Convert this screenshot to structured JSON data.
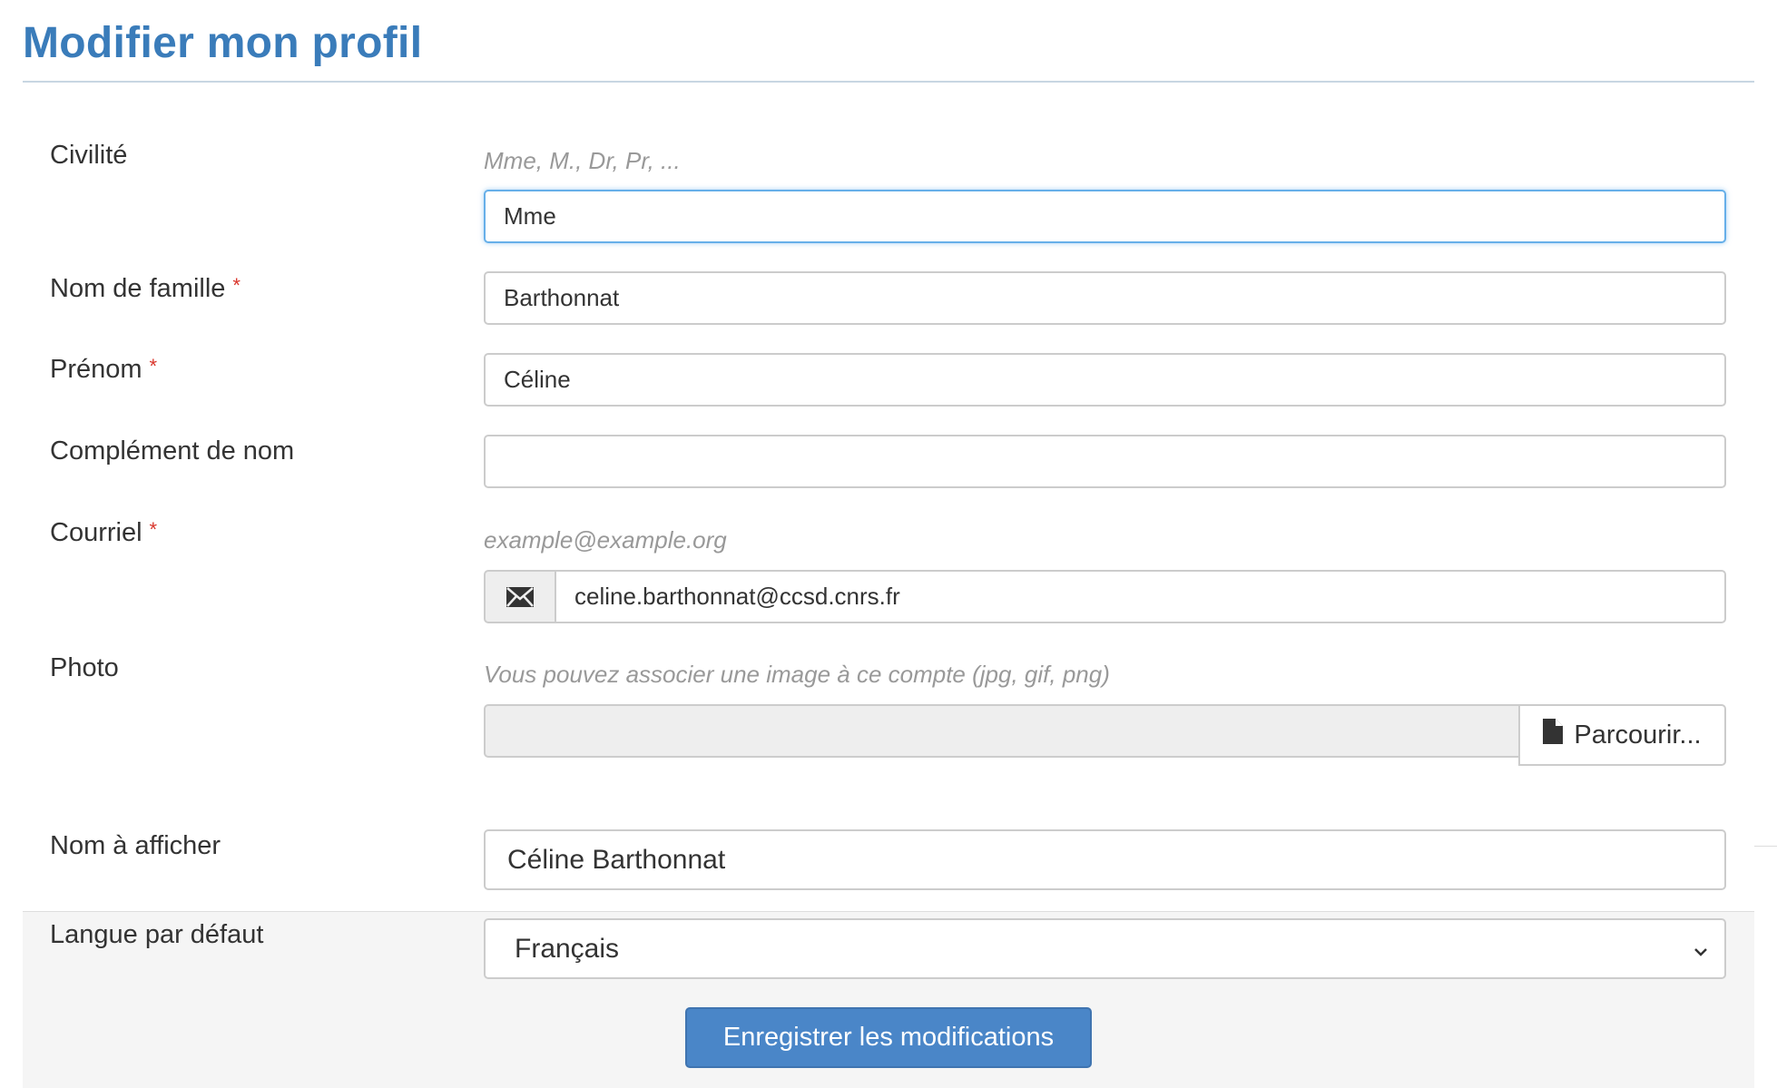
{
  "page": {
    "title": "Modifier mon profil"
  },
  "form": {
    "civilite": {
      "label": "Civilité",
      "hint": "Mme, M., Dr, Pr, ...",
      "value": "Mme"
    },
    "nom": {
      "label": "Nom de famille",
      "required_mark": "*",
      "value": "Barthonnat"
    },
    "prenom": {
      "label": "Prénom",
      "required_mark": "*",
      "value": "Céline"
    },
    "complement": {
      "label": "Complément de nom",
      "value": ""
    },
    "courriel": {
      "label": "Courriel",
      "required_mark": "*",
      "hint": "example@example.org",
      "value": "celine.barthonnat@ccsd.cnrs.fr",
      "icon": "envelope-icon"
    },
    "photo": {
      "label": "Photo",
      "hint": "Vous pouvez associer une image à ce compte (jpg, gif, png)",
      "button_label": "Parcourir...",
      "button_icon": "file-icon"
    },
    "nom_affiche": {
      "label": "Nom à afficher",
      "value": "Céline Barthonnat"
    },
    "langue": {
      "label": "Langue par défaut",
      "value": "Français"
    },
    "submit": {
      "label": "Enregistrer les modifications"
    }
  },
  "colors": {
    "title": "#3a7cba",
    "required": "#d9352b",
    "primary_button": "#4a86c8",
    "focus_border": "#66afe9"
  }
}
